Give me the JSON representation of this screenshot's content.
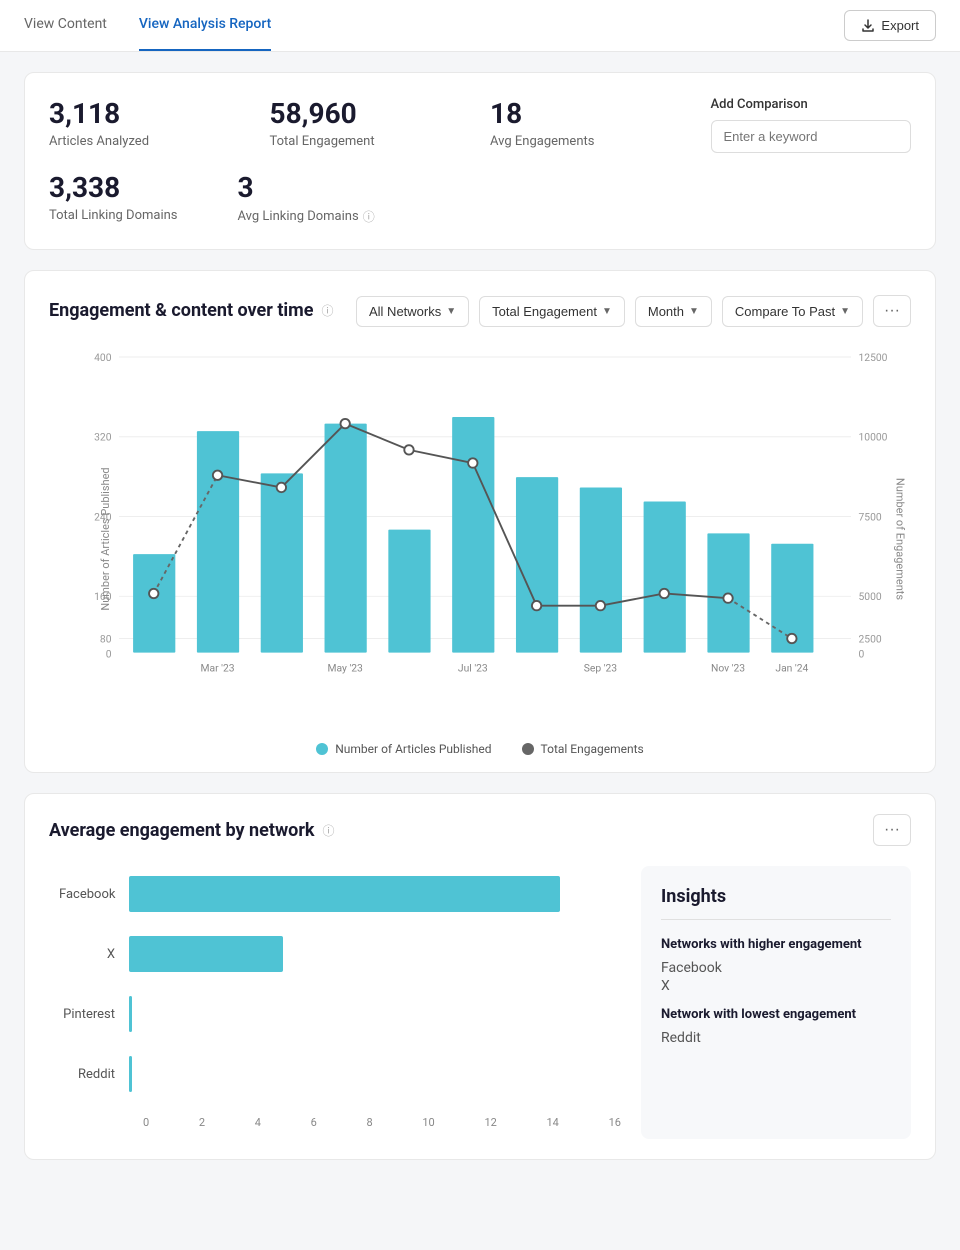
{
  "nav": {
    "tab_content": "View Content",
    "tab_analysis": "View Analysis Report",
    "export_label": "Export"
  },
  "stats": {
    "articles_number": "3,118",
    "articles_label": "Articles Analyzed",
    "total_eng_number": "58,960",
    "total_eng_label": "Total Engagement",
    "avg_eng_number": "18",
    "avg_eng_label": "Avg Engagements",
    "total_linking_number": "3,338",
    "total_linking_label": "Total Linking Domains",
    "avg_linking_number": "3",
    "avg_linking_label": "Avg Linking Domains",
    "add_comparison_label": "Add Comparison",
    "comparison_placeholder": "Enter a keyword"
  },
  "engagement_chart": {
    "title": "Engagement & content over time",
    "controls": {
      "networks_label": "All Networks",
      "engagement_label": "Total Engagement",
      "month_label": "Month",
      "compare_label": "Compare To Past",
      "more_label": "···"
    },
    "y_left_label": "Number of Articles Published",
    "y_right_label": "Number of Engagements",
    "legend_articles": "Number of Articles Published",
    "legend_engagements": "Total Engagements",
    "x_labels": [
      "Mar '23",
      "May '23",
      "Jul '23",
      "Sep '23",
      "Nov '23",
      "Jan '24"
    ],
    "bars": [
      140,
      315,
      255,
      325,
      175,
      335,
      250,
      235,
      215,
      170,
      155
    ],
    "line_points": [
      80,
      240,
      225,
      310,
      275,
      255,
      65,
      65,
      80,
      65,
      75,
      20
    ]
  },
  "avg_engagement": {
    "title": "Average engagement by network",
    "more_label": "···",
    "networks": [
      {
        "name": "Facebook",
        "value": 14,
        "max": 16
      },
      {
        "name": "X",
        "value": 5,
        "max": 16
      },
      {
        "name": "Pinterest",
        "value": 0.1,
        "max": 16
      },
      {
        "name": "Reddit",
        "value": 0.1,
        "max": 16
      }
    ],
    "x_axis_labels": [
      "0",
      "2",
      "4",
      "6",
      "8",
      "10",
      "12",
      "14",
      "16"
    ],
    "insights": {
      "title": "Insights",
      "higher_eng_title": "Networks with higher engagement",
      "higher_eng_values": [
        "Facebook",
        "X"
      ],
      "lowest_eng_title": "Network with lowest engagement",
      "lowest_eng_value": "Reddit"
    }
  }
}
